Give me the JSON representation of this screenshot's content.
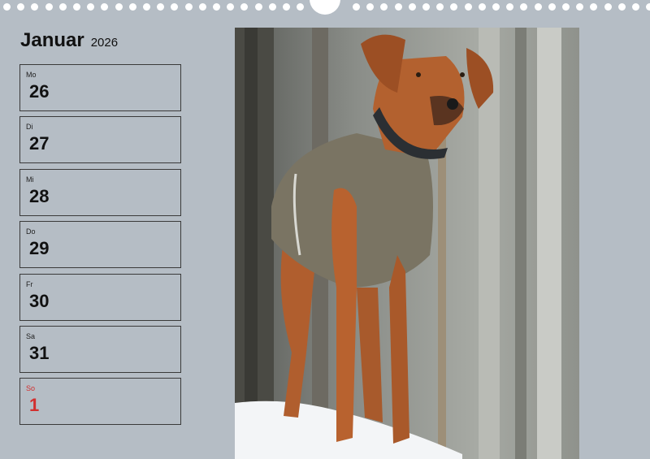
{
  "header": {
    "month": "Januar",
    "year": "2026"
  },
  "days": [
    {
      "weekday": "Mo",
      "day": "26"
    },
    {
      "weekday": "Di",
      "day": "27"
    },
    {
      "weekday": "Mi",
      "day": "28"
    },
    {
      "weekday": "Do",
      "day": "29"
    },
    {
      "weekday": "Fr",
      "day": "30"
    },
    {
      "weekday": "Sa",
      "day": "31"
    },
    {
      "weekday": "So",
      "day": "1"
    }
  ],
  "colors": {
    "background": "#b5bdc5",
    "sunday": "#d22f2f"
  },
  "photo": {
    "icon": "dog-photo"
  }
}
